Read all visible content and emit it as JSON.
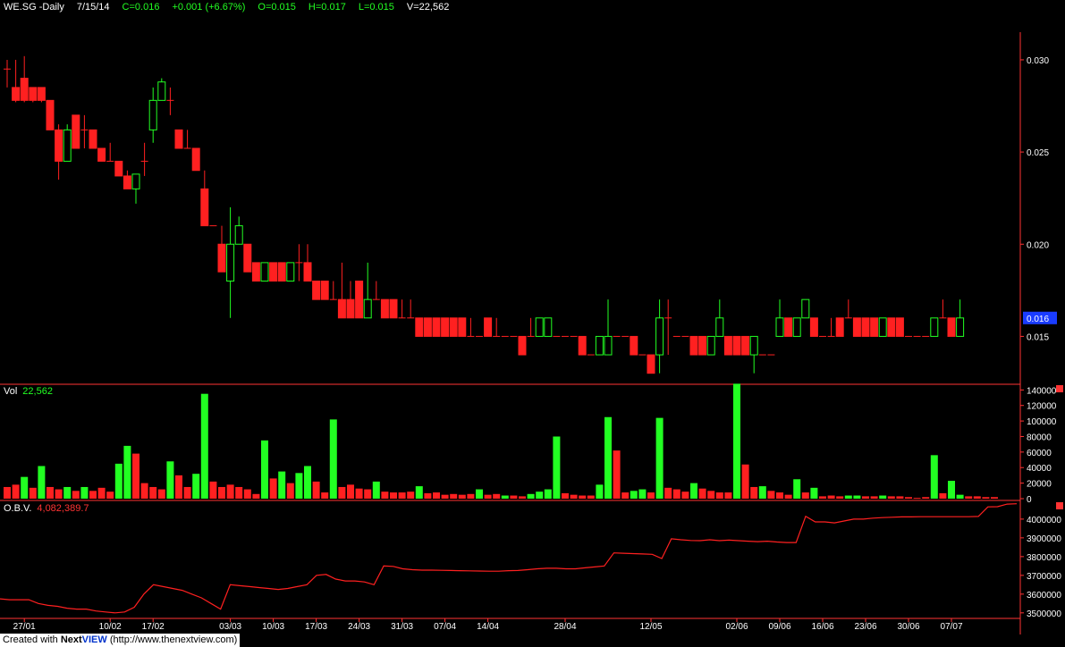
{
  "header": {
    "symbol": "WE.SG -Daily",
    "date": "7/15/14",
    "close": "C=0.016",
    "change": "+0.001 (+6.67%)",
    "open": "O=0.015",
    "high": "H=0.017",
    "low": "L=0.015",
    "volume": "V=22,562"
  },
  "volume_panel": {
    "label": "Vol",
    "value": "22,562"
  },
  "obv_panel": {
    "label": "O.B.V.",
    "value": "4,082,389.7"
  },
  "last_price_tag": "0.016",
  "credit": {
    "prefix": "Created with ",
    "brand_next": "Next",
    "brand_view": "VIEW",
    "url": " (http://www.thenextview.com)"
  },
  "colors": {
    "up": "#22ff22",
    "down": "#ff2020",
    "axis": "#ff3333",
    "obv": "#ff2020",
    "last_tag_bg": "#1a3cff"
  },
  "chart_data": [
    {
      "type": "candlestick",
      "title": "WE.SG -Daily",
      "ylim": [
        0.0125,
        0.0315
      ],
      "yticks": [
        "0.015",
        "0.020",
        "0.025",
        "0.030"
      ],
      "xticks": [
        {
          "label": "27/01",
          "index": 2
        },
        {
          "label": "10/02",
          "index": 12
        },
        {
          "label": "17/02",
          "index": 17
        },
        {
          "label": "03/03",
          "index": 26
        },
        {
          "label": "10/03",
          "index": 31
        },
        {
          "label": "17/03",
          "index": 36
        },
        {
          "label": "24/03",
          "index": 41
        },
        {
          "label": "31/03",
          "index": 46
        },
        {
          "label": "07/04",
          "index": 51
        },
        {
          "label": "14/04",
          "index": 56
        },
        {
          "label": "28/04",
          "index": 65
        },
        {
          "label": "12/05",
          "index": 75
        },
        {
          "label": "02/06",
          "index": 85
        },
        {
          "label": "09/06",
          "index": 90
        },
        {
          "label": "16/06",
          "index": 95
        },
        {
          "label": "23/06",
          "index": 100
        },
        {
          "label": "30/06",
          "index": 105
        },
        {
          "label": "07/07",
          "index": 110
        }
      ],
      "ohlc": [
        [
          0.0295,
          0.03,
          0.0285,
          0.0295
        ],
        [
          0.0285,
          0.03,
          0.0277,
          0.0278
        ],
        [
          0.029,
          0.0302,
          0.0277,
          0.0278
        ],
        [
          0.0285,
          0.0285,
          0.0277,
          0.0278
        ],
        [
          0.0285,
          0.0285,
          0.0277,
          0.0278
        ],
        [
          0.0278,
          0.0278,
          0.0262,
          0.0262
        ],
        [
          0.0262,
          0.0265,
          0.0235,
          0.0245
        ],
        [
          0.0245,
          0.0265,
          0.0245,
          0.0262
        ],
        [
          0.027,
          0.027,
          0.0252,
          0.0252
        ],
        [
          0.0262,
          0.027,
          0.0252,
          0.0262
        ],
        [
          0.0262,
          0.0262,
          0.0252,
          0.0252
        ],
        [
          0.0252,
          0.0252,
          0.0245,
          0.0245
        ],
        [
          0.0245,
          0.0255,
          0.0245,
          0.0245
        ],
        [
          0.0245,
          0.0245,
          0.0237,
          0.0237
        ],
        [
          0.0237,
          0.024,
          0.023,
          0.023
        ],
        [
          0.023,
          0.0238,
          0.0222,
          0.0238
        ],
        [
          0.0245,
          0.0255,
          0.0237,
          0.0245
        ],
        [
          0.0262,
          0.0285,
          0.0255,
          0.0278
        ],
        [
          0.0278,
          0.029,
          0.0278,
          0.0288
        ],
        [
          0.0278,
          0.0285,
          0.027,
          0.0278
        ],
        [
          0.0262,
          0.0262,
          0.0252,
          0.0252
        ],
        [
          0.0252,
          0.0262,
          0.0252,
          0.0252
        ],
        [
          0.0252,
          0.0252,
          0.024,
          0.024
        ],
        [
          0.023,
          0.024,
          0.021,
          0.021
        ],
        [
          0.021,
          0.021,
          0.021,
          0.021
        ],
        [
          0.02,
          0.021,
          0.0185,
          0.0185
        ],
        [
          0.018,
          0.022,
          0.016,
          0.02
        ],
        [
          0.02,
          0.0215,
          0.02,
          0.021
        ],
        [
          0.02,
          0.02,
          0.0185,
          0.0185
        ],
        [
          0.019,
          0.019,
          0.018,
          0.018
        ],
        [
          0.018,
          0.019,
          0.018,
          0.019
        ],
        [
          0.019,
          0.019,
          0.018,
          0.018
        ],
        [
          0.019,
          0.019,
          0.018,
          0.018
        ],
        [
          0.018,
          0.019,
          0.018,
          0.019
        ],
        [
          0.019,
          0.02,
          0.018,
          0.019
        ],
        [
          0.019,
          0.02,
          0.018,
          0.018
        ],
        [
          0.018,
          0.018,
          0.017,
          0.017
        ],
        [
          0.018,
          0.018,
          0.017,
          0.017
        ],
        [
          0.017,
          0.018,
          0.017,
          0.017
        ],
        [
          0.017,
          0.019,
          0.016,
          0.016
        ],
        [
          0.017,
          0.018,
          0.016,
          0.016
        ],
        [
          0.018,
          0.018,
          0.016,
          0.016
        ],
        [
          0.016,
          0.019,
          0.016,
          0.017
        ],
        [
          0.017,
          0.018,
          0.017,
          0.017
        ],
        [
          0.017,
          0.017,
          0.016,
          0.016
        ],
        [
          0.017,
          0.017,
          0.016,
          0.016
        ],
        [
          0.016,
          0.017,
          0.016,
          0.016
        ],
        [
          0.016,
          0.017,
          0.016,
          0.016
        ],
        [
          0.016,
          0.016,
          0.015,
          0.015
        ],
        [
          0.016,
          0.016,
          0.015,
          0.015
        ],
        [
          0.016,
          0.016,
          0.015,
          0.015
        ],
        [
          0.016,
          0.016,
          0.015,
          0.015
        ],
        [
          0.016,
          0.016,
          0.015,
          0.015
        ],
        [
          0.016,
          0.016,
          0.015,
          0.015
        ],
        [
          0.015,
          0.016,
          0.015,
          0.015
        ],
        [
          0.015,
          0.015,
          0.015,
          0.015
        ],
        [
          0.016,
          0.016,
          0.015,
          0.015
        ],
        [
          0.015,
          0.016,
          0.015,
          0.015
        ],
        [
          0.015,
          0.015,
          0.015,
          0.015
        ],
        [
          0.015,
          0.015,
          0.015,
          0.015
        ],
        [
          0.015,
          0.015,
          0.014,
          0.014
        ],
        [
          0.015,
          0.016,
          0.015,
          0.015
        ],
        [
          0.015,
          0.016,
          0.015,
          0.016
        ],
        [
          0.015,
          0.016,
          0.015,
          0.016
        ],
        [
          0.015,
          0.015,
          0.015,
          0.015
        ],
        [
          0.015,
          0.015,
          0.015,
          0.015
        ],
        [
          0.015,
          0.015,
          0.015,
          0.015
        ],
        [
          0.015,
          0.015,
          0.014,
          0.014
        ],
        [
          0.014,
          0.014,
          0.014,
          0.014
        ],
        [
          0.014,
          0.015,
          0.014,
          0.015
        ],
        [
          0.014,
          0.017,
          0.014,
          0.015
        ],
        [
          0.015,
          0.015,
          0.015,
          0.015
        ],
        [
          0.015,
          0.015,
          0.015,
          0.015
        ],
        [
          0.015,
          0.015,
          0.014,
          0.014
        ],
        [
          0.014,
          0.014,
          0.014,
          0.014
        ],
        [
          0.014,
          0.014,
          0.013,
          0.013
        ],
        [
          0.014,
          0.017,
          0.013,
          0.016
        ],
        [
          0.016,
          0.017,
          0.014,
          0.016
        ],
        [
          0.015,
          0.015,
          0.015,
          0.015
        ],
        [
          0.015,
          0.015,
          0.015,
          0.015
        ],
        [
          0.015,
          0.015,
          0.014,
          0.014
        ],
        [
          0.015,
          0.015,
          0.014,
          0.014
        ],
        [
          0.014,
          0.015,
          0.014,
          0.015
        ],
        [
          0.015,
          0.017,
          0.015,
          0.016
        ],
        [
          0.015,
          0.015,
          0.014,
          0.014
        ],
        [
          0.015,
          0.015,
          0.014,
          0.014
        ],
        [
          0.015,
          0.015,
          0.014,
          0.014
        ],
        [
          0.014,
          0.015,
          0.013,
          0.015
        ],
        [
          0.014,
          0.014,
          0.014,
          0.014
        ],
        [
          0.014,
          0.014,
          0.014,
          0.014
        ],
        [
          0.015,
          0.017,
          0.015,
          0.016
        ],
        [
          0.016,
          0.016,
          0.015,
          0.015
        ],
        [
          0.015,
          0.016,
          0.015,
          0.016
        ],
        [
          0.016,
          0.017,
          0.016,
          0.017
        ],
        [
          0.016,
          0.016,
          0.015,
          0.015
        ],
        [
          0.015,
          0.015,
          0.015,
          0.015
        ],
        [
          0.015,
          0.016,
          0.015,
          0.015
        ],
        [
          0.016,
          0.016,
          0.015,
          0.015
        ],
        [
          0.016,
          0.017,
          0.016,
          0.016
        ],
        [
          0.016,
          0.016,
          0.015,
          0.015
        ],
        [
          0.016,
          0.016,
          0.015,
          0.015
        ],
        [
          0.016,
          0.016,
          0.015,
          0.015
        ],
        [
          0.015,
          0.016,
          0.015,
          0.016
        ],
        [
          0.016,
          0.016,
          0.015,
          0.015
        ],
        [
          0.016,
          0.016,
          0.015,
          0.015
        ],
        [
          0.015,
          0.015,
          0.015,
          0.015
        ],
        [
          0.015,
          0.015,
          0.015,
          0.015
        ],
        [
          0.015,
          0.015,
          0.015,
          0.015
        ],
        [
          0.015,
          0.016,
          0.015,
          0.016
        ],
        [
          0.016,
          0.017,
          0.016,
          0.016
        ],
        [
          0.016,
          0.016,
          0.015,
          0.015
        ],
        [
          0.015,
          0.017,
          0.015,
          0.016
        ]
      ]
    },
    {
      "type": "bar",
      "title": "Vol",
      "ylim": [
        0,
        145000
      ],
      "yticks": [
        "0",
        "20000",
        "40000",
        "60000",
        "80000",
        "100000",
        "120000",
        "140000"
      ],
      "values": [
        15000,
        18000,
        28000,
        14000,
        42000,
        15000,
        12000,
        15000,
        10000,
        15000,
        10000,
        14000,
        9000,
        45000,
        68000,
        58000,
        20000,
        15000,
        12000,
        48000,
        30000,
        15000,
        32000,
        135000,
        22000,
        15000,
        18000,
        15000,
        12000,
        6000,
        75000,
        26000,
        35000,
        20000,
        33000,
        42000,
        22000,
        8000,
        102000,
        15000,
        18000,
        13000,
        12000,
        22000,
        9000,
        8000,
        8000,
        9000,
        16000,
        7000,
        8000,
        5000,
        6000,
        5000,
        6000,
        12000,
        5000,
        6000,
        4000,
        4000,
        3000,
        6000,
        9000,
        12000,
        80000,
        7000,
        5000,
        4000,
        4000,
        18000,
        105000,
        62000,
        8000,
        10000,
        12000,
        8000,
        104000,
        14000,
        12000,
        9000,
        20000,
        13000,
        10000,
        8000,
        8000,
        148000,
        44000,
        15000,
        16000,
        10000,
        8000,
        5000,
        25000,
        8000,
        14000,
        3000,
        4000,
        3000,
        4000,
        4000,
        3000,
        3000,
        4000,
        3000,
        3000,
        2000,
        1000,
        2000,
        56000,
        7000,
        23000,
        5000,
        3000,
        3000,
        2000,
        2000
      ],
      "up": [
        false,
        false,
        true,
        false,
        true,
        false,
        false,
        true,
        false,
        true,
        false,
        false,
        false,
        true,
        true,
        false,
        false,
        false,
        false,
        true,
        false,
        false,
        true,
        true,
        false,
        false,
        false,
        false,
        false,
        false,
        true,
        false,
        true,
        false,
        true,
        true,
        false,
        false,
        true,
        false,
        false,
        false,
        false,
        true,
        false,
        false,
        false,
        false,
        true,
        false,
        false,
        false,
        false,
        false,
        false,
        true,
        false,
        false,
        true,
        false,
        false,
        true,
        true,
        true,
        true,
        false,
        false,
        false,
        false,
        true,
        true,
        false,
        false,
        true,
        true,
        false,
        true,
        false,
        false,
        false,
        true,
        false,
        false,
        false,
        false,
        true,
        false,
        false,
        true,
        false,
        false,
        false,
        true,
        false,
        true,
        false,
        false,
        false,
        true,
        true,
        false,
        false,
        true,
        false,
        false,
        false,
        false,
        false,
        true,
        false,
        true,
        true,
        false,
        false,
        false,
        false
      ]
    },
    {
      "type": "line",
      "title": "O.B.V.",
      "ylim": [
        3480000,
        4090000
      ],
      "yticks": [
        "3500000",
        "3600000",
        "3700000",
        "3800000",
        "3900000",
        "4000000"
      ],
      "values": [
        3575000,
        3570000,
        3570000,
        3570000,
        3550000,
        3540000,
        3535000,
        3525000,
        3520000,
        3520000,
        3510000,
        3505000,
        3500000,
        3505000,
        3530000,
        3600000,
        3650000,
        3640000,
        3630000,
        3620000,
        3600000,
        3580000,
        3550000,
        3520000,
        3650000,
        3645000,
        3640000,
        3635000,
        3630000,
        3625000,
        3630000,
        3640000,
        3650000,
        3700000,
        3705000,
        3680000,
        3670000,
        3670000,
        3665000,
        3650000,
        3750000,
        3748000,
        3735000,
        3730000,
        3728000,
        3728000,
        3727000,
        3726000,
        3725000,
        3724000,
        3723000,
        3722000,
        3722000,
        3725000,
        3726000,
        3730000,
        3735000,
        3738000,
        3738000,
        3735000,
        3735000,
        3740000,
        3745000,
        3750000,
        3820000,
        3818000,
        3816000,
        3814000,
        3812000,
        3790000,
        3895000,
        3890000,
        3886000,
        3885000,
        3890000,
        3885000,
        3888000,
        3885000,
        3882000,
        3880000,
        3882000,
        3878000,
        3875000,
        3875000,
        4015000,
        3985000,
        3985000,
        3980000,
        3990000,
        4000000,
        4000000,
        4005000,
        4008000,
        4010000,
        4012000,
        4012000,
        4013000,
        4013000,
        4013000,
        4013000,
        4013000,
        4013000,
        4014000,
        4065000,
        4066000,
        4080000,
        4082000
      ]
    }
  ]
}
